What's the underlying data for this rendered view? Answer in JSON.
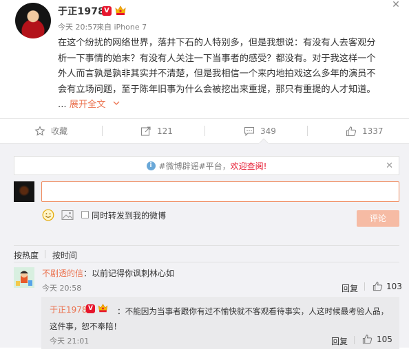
{
  "post": {
    "author": "于正1978",
    "verified_badge": "V",
    "time": "今天 20:57",
    "source": "来自 iPhone 7",
    "text_lines": [
      "在这个纷扰的网络世界，落井下石的人特别多，但是我想说：有没有人去客观分",
      "析一下事情的始末？有没有人关注一下当事者的感受？都没有。对于我这样一个",
      "外人而言孰是孰非其实并不清楚，但是我相信一个来内地拍戏这么多年的演员不",
      "会有立场问题，至于陈年旧事为什么会被挖出来重提，那只有重提的人才知道。"
    ],
    "ellipsis": "...",
    "expand_label": "展开全文"
  },
  "actions": {
    "favorite_label": "收藏",
    "repost_count": "121",
    "comment_count": "349",
    "like_count": "1337"
  },
  "notice": {
    "prefix": "#微博辟谣#平台，",
    "highlight": "欢迎查阅!"
  },
  "composer": {
    "input_value": "",
    "repost_label": "同时转发到我的微博",
    "submit_label": "评论"
  },
  "sort": {
    "hot": "按热度",
    "time": "按时间"
  },
  "comments": [
    {
      "user": "不剧透的信",
      "text": "：以前记得你讽刺林心如",
      "time": "今天 20:58",
      "reply_label": "回复",
      "likes": "103",
      "reply": {
        "user": "于正1978",
        "verified_badge": "V",
        "text": "：不能因为当事者跟你有过不愉快就不客观看待事实，人这时候最考验人品，这件事，恕不奉陪！",
        "time": "今天 21:01",
        "reply_label": "回复",
        "likes": "105"
      }
    }
  ],
  "colors": {
    "accent": "#eb7350",
    "verified": "#e6162d",
    "muted": "#808080",
    "submit_disabled": "#f6bba4"
  },
  "icons": {
    "close": "close-icon",
    "favorite": "star-icon",
    "repost": "repost-icon",
    "comment": "comment-icon",
    "like": "thumbs-up-icon"
  }
}
